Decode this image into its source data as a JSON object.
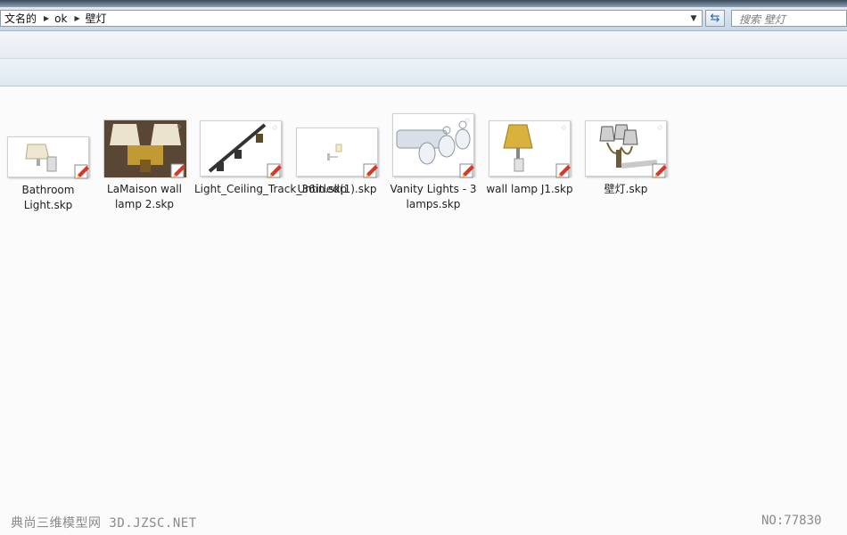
{
  "address": {
    "crumbs": [
      "文名的",
      "ok",
      "壁灯"
    ],
    "search_placeholder": "搜索 壁灯"
  },
  "files": [
    {
      "label": "Bathroom Light.skp",
      "icon": "wall-sconce-thumbnail"
    },
    {
      "label": "LaMaison wall lamp 2.skp",
      "icon": "double-wall-lamp-thumbnail"
    },
    {
      "label": "Light_Ceiling_Track_36in.skp",
      "icon": "track-light-thumbnail"
    },
    {
      "label": "Untitled(1).skp",
      "icon": "small-sconce-thumbnail"
    },
    {
      "label": "Vanity Lights - 3 lamps.skp",
      "icon": "vanity-lights-thumbnail"
    },
    {
      "label": "wall lamp J1.skp",
      "icon": "gold-wall-lamp-thumbnail"
    },
    {
      "label": "壁灯.skp",
      "icon": "chandelier-sconce-thumbnail"
    }
  ],
  "watermark": {
    "left": "典尚三维模型网 3D.JZSC.NET",
    "right": "NO:77830"
  }
}
